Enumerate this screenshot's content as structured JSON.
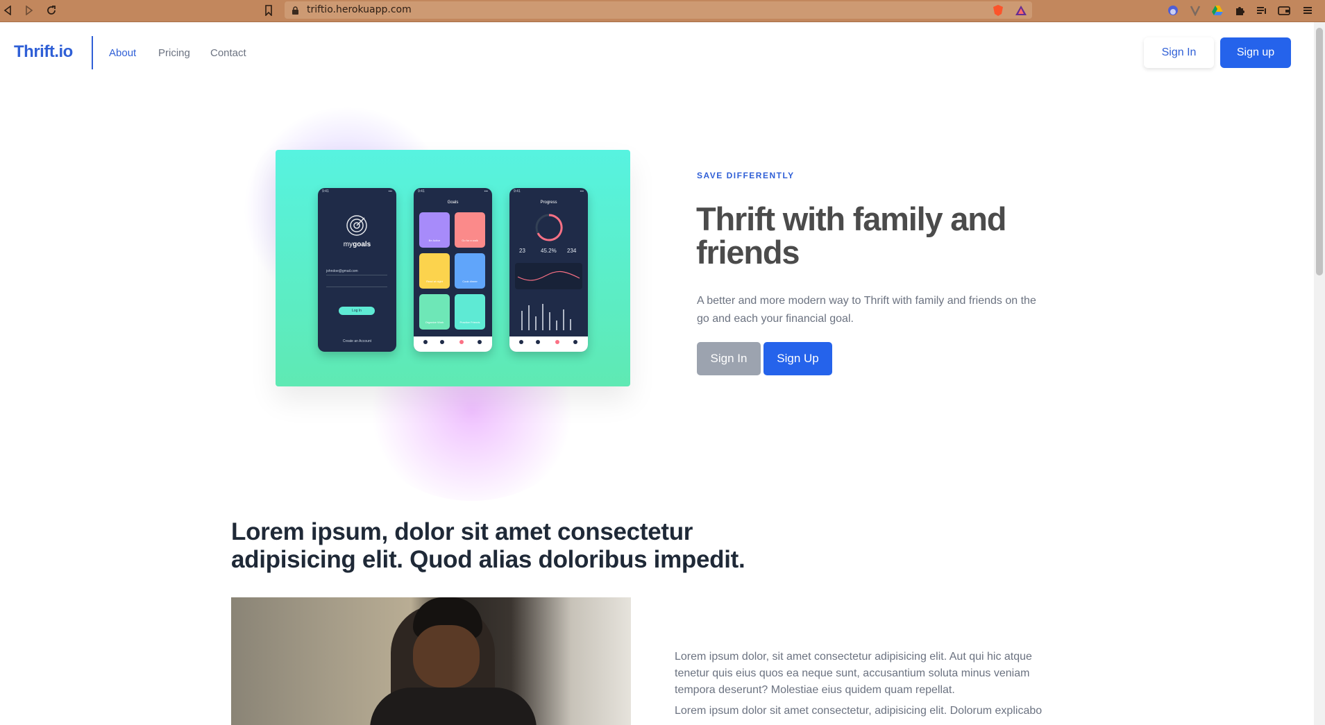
{
  "browser": {
    "url": "triftio.herokuapp.com"
  },
  "header": {
    "logo": "Thrift.io",
    "nav": [
      "About",
      "Pricing",
      "Contact"
    ],
    "sign_in": "Sign In",
    "sign_up": "Sign up"
  },
  "hero": {
    "eyebrow": "SAVE DIFFERENTLY",
    "title": "Thrift with family and friends",
    "description": "A better and more modern way to Thrift with family and friends on the go and each your financial goal.",
    "sign_in": "Sign In",
    "sign_up": "Sign Up",
    "phone1": {
      "brand_light": "my",
      "brand_bold": "goals",
      "email": "johndoe@gmail.com",
      "button": "Log In",
      "footer": "Create an Account"
    },
    "phone2": {
      "title": "Goals",
      "tiles": [
        "Be Active",
        "Go for a walk",
        "Read at night",
        "Cook dinner",
        "Organize Work",
        "Practice Friends"
      ]
    },
    "phone3": {
      "title": "Progress",
      "stats": [
        "23",
        "45.2%",
        "234"
      ]
    }
  },
  "section2": {
    "title": "Lorem ipsum, dolor sit amet consectetur adipisicing elit. Quod alias doloribus impedit.",
    "para1": "Lorem ipsum dolor, sit amet consectetur adipisicing elit. Aut qui hic atque tenetur quis eius quos ea neque sunt, accusantium soluta minus veniam tempora deserunt? Molestiae eius quidem quam repellat.",
    "para2": "Lorem ipsum dolor sit amet consectetur, adipisicing elit. Dolorum explicabo"
  },
  "colors": {
    "brand": "#2f5fd6",
    "button_blue": "#2563eb",
    "chrome": "#c2875d",
    "hero_gradient_top": "#57f3e0",
    "hero_gradient_bottom": "#5fe9b3"
  }
}
